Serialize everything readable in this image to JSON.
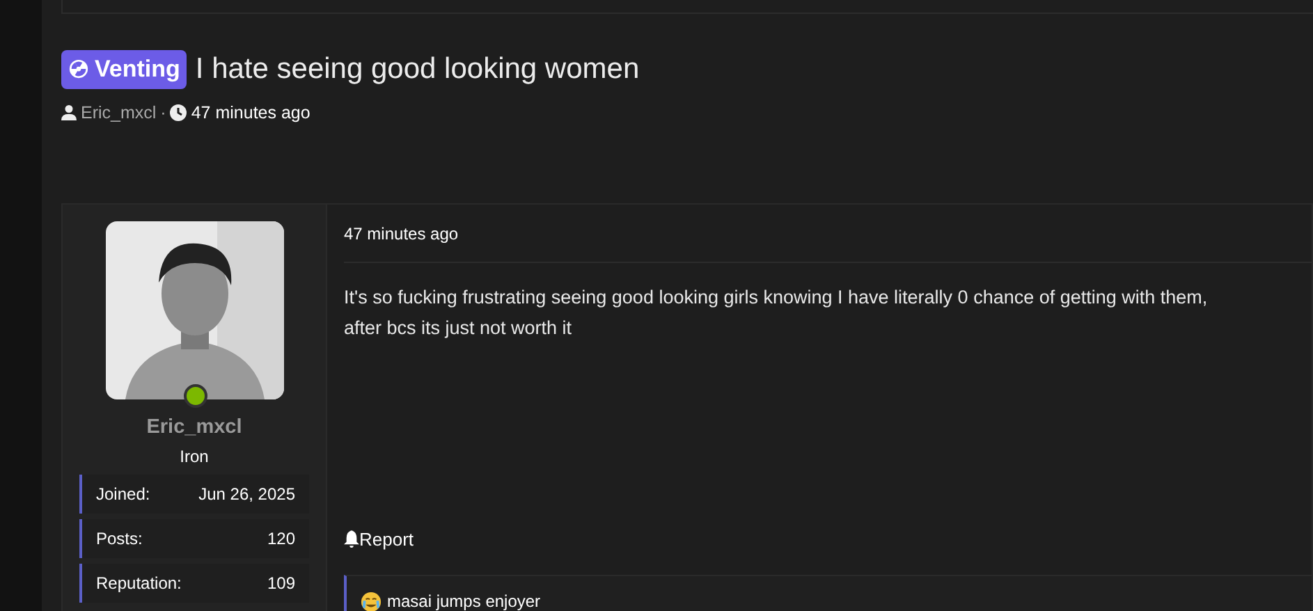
{
  "thread": {
    "prefix": "Venting",
    "title": "I hate seeing good looking women",
    "author": "Eric_mxcl",
    "separator": "·",
    "time": "47 minutes ago"
  },
  "post": {
    "user": {
      "name": "Eric_mxcl",
      "rank": "Iron",
      "online": true,
      "stats": [
        {
          "label": "Joined:",
          "value": "Jun 26, 2025"
        },
        {
          "label": "Posts:",
          "value": "120"
        },
        {
          "label": "Reputation:",
          "value": "109"
        }
      ]
    },
    "time": "47 minutes ago",
    "body_lines": [
      "It's so fucking frustrating seeing good looking girls knowing I have literally 0 chance of getting with them,",
      "after bcs its just not worth it"
    ],
    "report": "Report",
    "signature": "masai jumps enjoyer"
  }
}
